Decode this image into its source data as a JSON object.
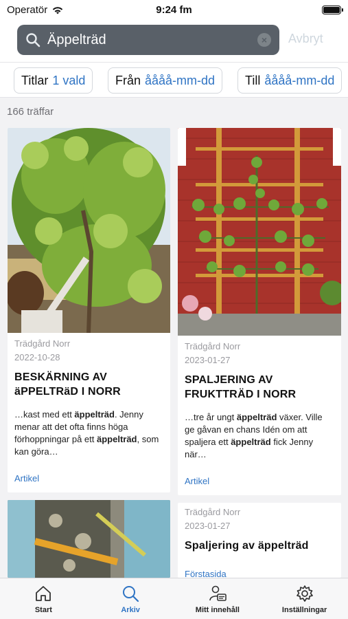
{
  "status": {
    "carrier": "Operatör",
    "time": "9:24 fm"
  },
  "search": {
    "value": "Äppelträd",
    "cancel_label": "Avbryt"
  },
  "filters": [
    {
      "key": "Titlar",
      "value": "1 vald"
    },
    {
      "key": "Från",
      "value": "åååå-mm-dd"
    },
    {
      "key": "Till",
      "value": "åååå-mm-dd"
    }
  ],
  "results_count": "166 träffar",
  "cards": [
    {
      "source": "Trädgård Norr",
      "date": "2022-10-28",
      "title_line1": "BESKÄRNING AV",
      "title_line2": "äPPELTRäD I NORR",
      "excerpt": [
        {
          "t": "…kast med ett ",
          "b": false
        },
        {
          "t": "äppelträd",
          "b": true
        },
        {
          "t": ". Jenny menar att det ofta finns höga förhoppningar på ett ",
          "b": false
        },
        {
          "t": "äppelträd",
          "b": true
        },
        {
          "t": ", som kan göra…",
          "b": false
        }
      ],
      "type": "Artikel"
    },
    {
      "source": "Trädgård Norr",
      "date": "2023-01-27",
      "title_line1": "SPALJERING AV",
      "title_line2": "FRUKTTRÄD I NORR",
      "excerpt": [
        {
          "t": "…tre år ungt ",
          "b": false
        },
        {
          "t": "äppelträd",
          "b": true
        },
        {
          "t": " växer. Ville ge gåvan en chans Idén om att spaljera ett ",
          "b": false
        },
        {
          "t": "äppelträd",
          "b": true
        },
        {
          "t": " fick Jenny när…",
          "b": false
        }
      ],
      "type": "Artikel"
    },
    {
      "source": "Trädgård Norr",
      "date": "2023-01-27",
      "title": "Spaljering av äppelträd",
      "type": "Förstasida"
    }
  ],
  "tabs": [
    {
      "label": "Start",
      "icon": "home-icon",
      "active": false
    },
    {
      "label": "Arkiv",
      "icon": "search-icon",
      "active": true
    },
    {
      "label": "Mitt innehåll",
      "icon": "person-card-icon",
      "active": false
    },
    {
      "label": "Inställningar",
      "icon": "gear-icon",
      "active": false
    }
  ],
  "colors": {
    "accent": "#2f74c4",
    "search_bg": "#596068",
    "barn_red": "#a8332b"
  }
}
